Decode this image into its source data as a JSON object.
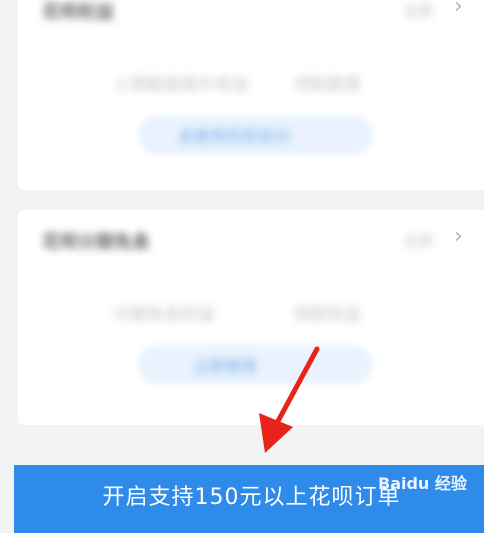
{
  "card1": {
    "title": "花呗权益",
    "link": "全部",
    "desc_left": "上限额度提升权益",
    "desc_right": "领取额度",
    "button": "去使用花呗支付"
  },
  "card2": {
    "title": "花呗分期免息",
    "link": "全部",
    "desc_left": "分期免息权益",
    "desc_right": "领取权益",
    "button": "立即使用"
  },
  "bottom_bar": {
    "label": "开启支持150元以上花呗订单"
  },
  "watermark": {
    "text": "Baidu 经验"
  }
}
